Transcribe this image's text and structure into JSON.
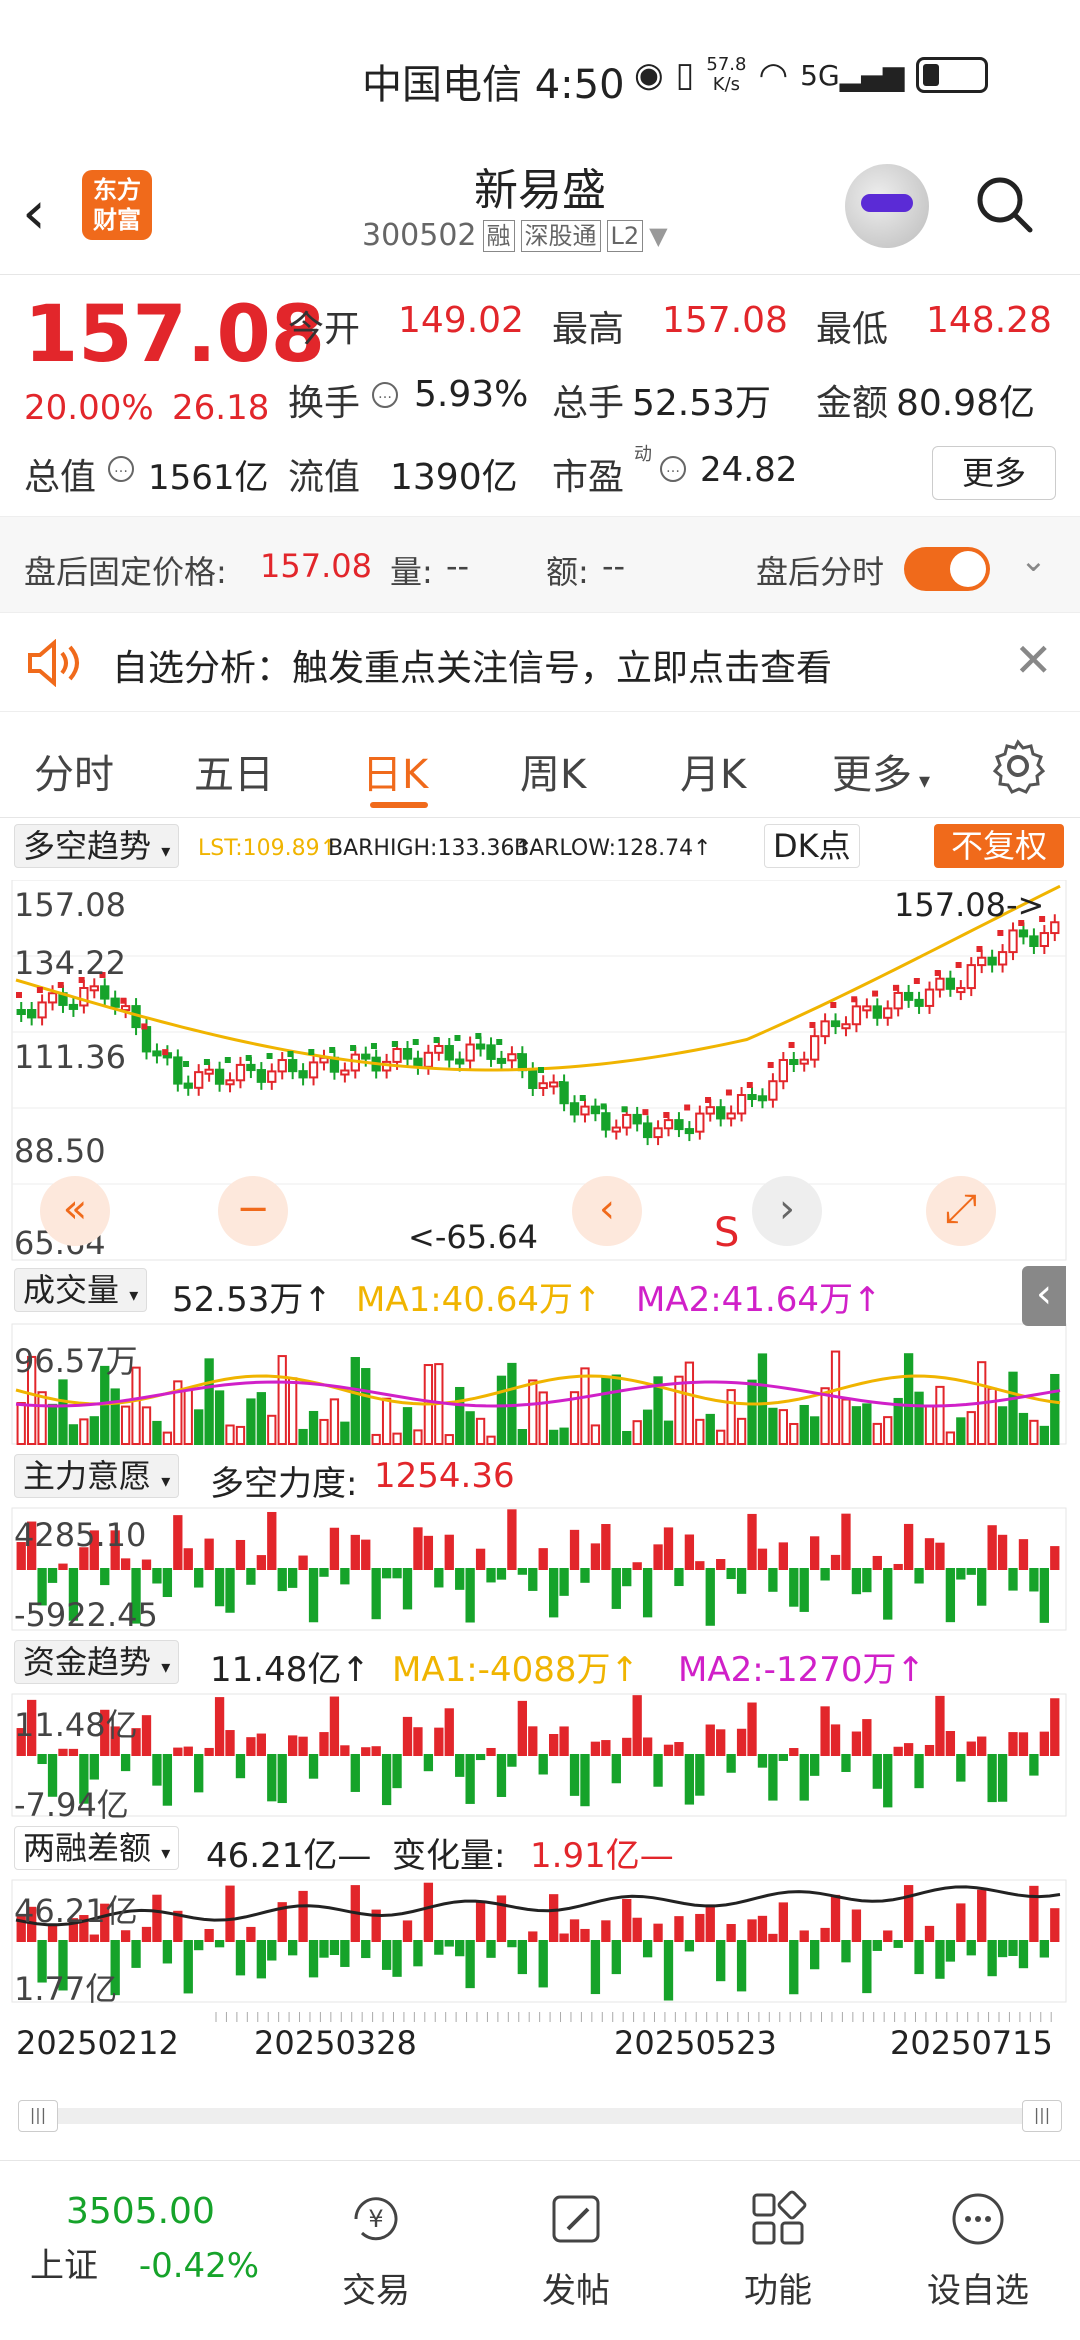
{
  "status_bar": {
    "carrier_time": "中国电信 4:50",
    "net_speed_value": "57.8",
    "net_speed_unit": "K/s"
  },
  "header": {
    "title": "新易盛",
    "code": "300502",
    "tag1": "融",
    "tag2": "深股通",
    "tag3": "L2",
    "logo_text": "东方财富",
    "search_icon": "search-icon",
    "back_icon": "chevron-left-icon"
  },
  "quote": {
    "price": "157.08",
    "pct": "20.00%",
    "change": "26.18",
    "open_label": "今开",
    "open": "149.02",
    "high_label": "最高",
    "high": "157.08",
    "low_label": "最低",
    "low": "148.28",
    "turnover_label": "换手",
    "turnover": "5.93%",
    "volume_label": "总手",
    "volume": "52.53万",
    "amount_label": "金额",
    "amount": "80.98亿",
    "mktcap_label": "总值",
    "mktcap": "1561亿",
    "float_label": "流值",
    "float": "1390亿",
    "pe_label": "市盈",
    "pe_sup": "动",
    "pe": "24.82",
    "more": "更多"
  },
  "after_hours": {
    "price_label": "盘后固定价格:",
    "price": "157.08",
    "vol_label": "量:",
    "vol": "--",
    "amt_label": "额:",
    "amt": "--",
    "toggle_label": "盘后分时"
  },
  "alert": {
    "text": "自选分析：触发重点关注信号，立即点击查看"
  },
  "tabs": [
    "分时",
    "五日",
    "日K",
    "周K",
    "月K",
    "更多"
  ],
  "chart": {
    "indicator1": "多空趋势",
    "lst": "LST:109.89↑",
    "barhigh": "BARHIGH:133.36↑",
    "barlow": "BARLOW:128.74↑",
    "dk_btn": "DK点",
    "fq_btn": "不复权",
    "y_top": "157.08",
    "y_2": "134.22",
    "y_3": "111.36",
    "y_4": "88.50",
    "y_bot": "65.64",
    "last_marker": "157.08->",
    "low_marker": "<-65.64",
    "signal_s": "S",
    "vol_label": "成交量",
    "vol_val": "52.53万↑",
    "vol_ma1": "MA1:40.64万↑",
    "vol_ma2": "MA2:41.64万↑",
    "vol_axis": "96.57万",
    "zl_label": "主力意愿",
    "zl_title": "多空力度:",
    "zl_val": "1254.36",
    "zl_top": "4285.10",
    "zl_bot": "-5922.45",
    "zj_label": "资金趋势",
    "zj_val": "11.48亿↑",
    "zj_ma1": "MA1:-4088万↑",
    "zj_ma2": "MA2:-1270万↑",
    "zj_top": "11.48亿",
    "zj_bot": "-7.94亿",
    "lr_label": "两融差额",
    "lr_val": "46.21亿—",
    "lr_chg_label": "变化量:",
    "lr_chg": "1.91亿—",
    "lr_top": "46.21亿",
    "lr_bot": "1.77亿",
    "dates": [
      "20250212",
      "20250328",
      "20250523",
      "20250715"
    ]
  },
  "bottom": {
    "index_val": "3505.00",
    "index_name": "上证",
    "index_pct": "-0.42%",
    "trade": "交易",
    "post": "发帖",
    "func": "功能",
    "watch": "设自选"
  },
  "colors": {
    "up": "#e2262b",
    "down": "#16a32a",
    "accent": "#f06a1b",
    "ma_yellow": "#f0b400",
    "ma_magenta": "#d020c8"
  }
}
